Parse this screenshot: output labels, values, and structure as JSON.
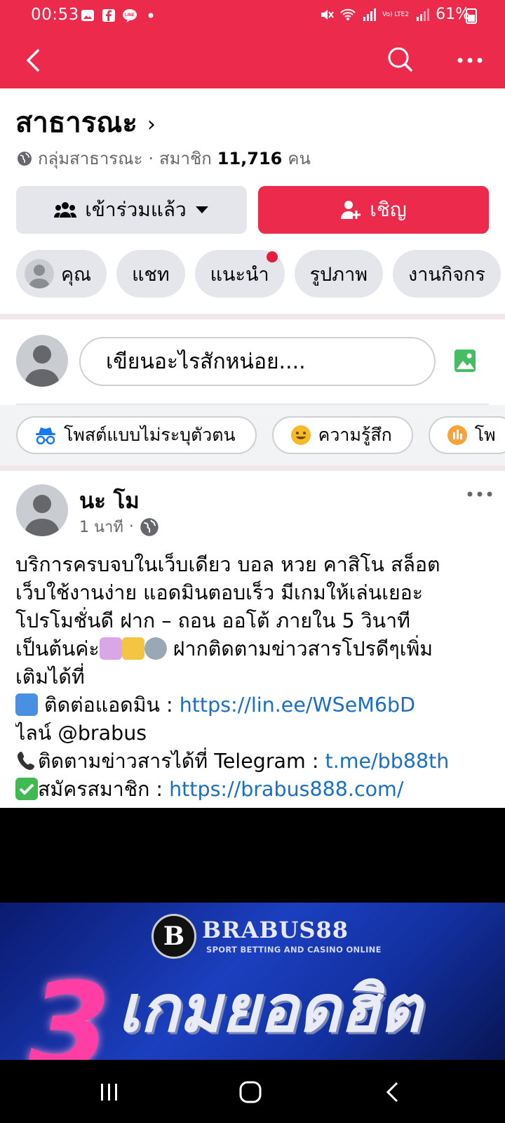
{
  "status_bar": {
    "time": "00:53",
    "battery": "61%",
    "network_label": "Vo) LTE2"
  },
  "app_bar": {
    "back_icon": "arrow-left-icon",
    "search_icon": "search-icon",
    "more_icon": "more-horizontal-icon",
    "bg_color": "#ec2a4b"
  },
  "group": {
    "name": "สาธารณะ",
    "privacy": "กลุ่มสาธารณะ",
    "member_prefix": "สมาชิก",
    "member_count": "11,716",
    "member_suffix": "คน",
    "joined_label": "เข้าร่วมแล้ว",
    "invite_label": "เชิญ"
  },
  "tabs": [
    {
      "label": "คุณ"
    },
    {
      "label": "แชท"
    },
    {
      "label": "แนะนำ"
    },
    {
      "label": "รูปภาพ"
    },
    {
      "label": "งานกิจกร"
    }
  ],
  "composer": {
    "placeholder": "เขียนอะไรสักหน่อย...."
  },
  "chips": [
    {
      "label": "โพสต์แบบไม่ระบุตัวตน",
      "icon": "incognito-icon"
    },
    {
      "label": "ความรู้สึก",
      "icon": "smiley-icon"
    },
    {
      "label": "โพ",
      "icon": "poll-icon"
    }
  ],
  "post": {
    "author": "นะ โม",
    "time": "1 นาที",
    "body_lines": [
      "บริการครบจบในเว็บเดียว บอล หวย คาสิโน สล็อต",
      "เว็บใช้งานง่าย แอดมินตอบเร็ว มีเกมให้เล่นเยอะ",
      "โปรโมชั่นดี ฝาก – ถอน ออโต้ ภายใน 5 วินาที",
      "เป็นต้นค่ะ",
      "ฝากติดตามข่าวสารโปรดีๆเพิ่ม",
      "เติมได้ที่"
    ],
    "contact_label": " ติดต่อแอดมิน : ",
    "contact_link": "https://lin.ee/WSeM6bD",
    "line_id": "ไลน์ @brabus",
    "telegram_label": "ติดตามข่าวสารได้ที่ Telegram : ",
    "telegram_link": "t.me/bb88th",
    "register_label": "สมัครสมาชิก : ",
    "register_link": "https://brabus888.com/"
  },
  "banner": {
    "logo_letter": "B",
    "brand": "BRABUS88",
    "tagline": "SPORT BETTING AND CASINO ONLINE",
    "big_number": "3",
    "headline": "เกมยอดฮิต"
  }
}
